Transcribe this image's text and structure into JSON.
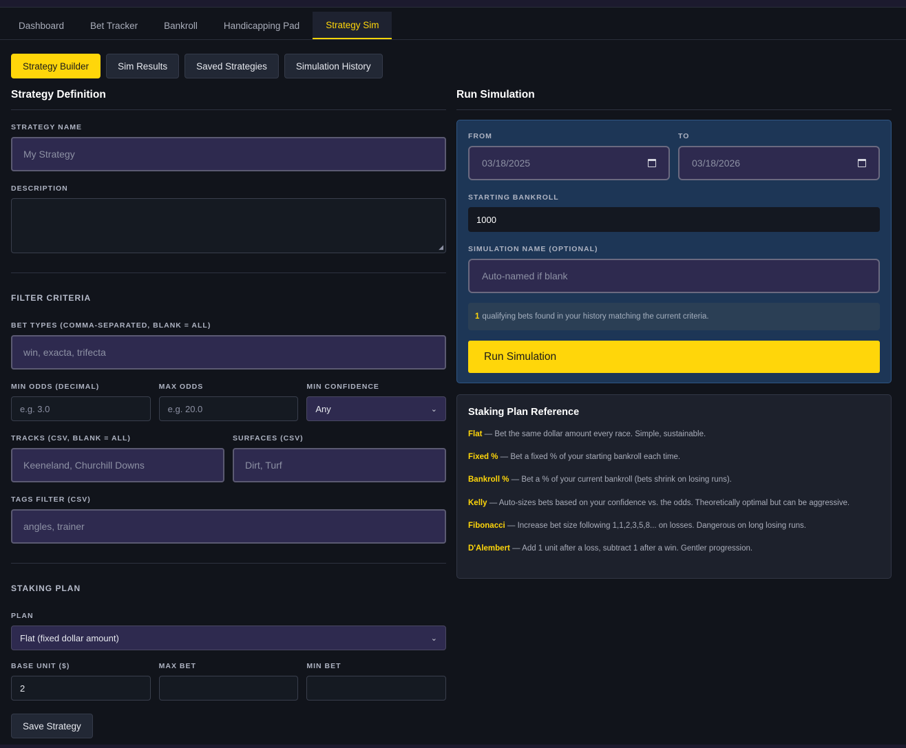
{
  "nav": {
    "tabs": [
      "Dashboard",
      "Bet Tracker",
      "Bankroll",
      "Handicapping Pad",
      "Strategy Sim"
    ],
    "active": "Strategy Sim"
  },
  "subtabs": {
    "items": [
      "Strategy Builder",
      "Sim Results",
      "Saved Strategies",
      "Simulation History"
    ],
    "active": "Strategy Builder"
  },
  "definition": {
    "title": "Strategy Definition",
    "name_label": "STRATEGY NAME",
    "name_placeholder": "My Strategy",
    "description_label": "DESCRIPTION"
  },
  "filters": {
    "heading": "FILTER CRITERIA",
    "bet_types_label": "BET TYPES (COMMA-SEPARATED, BLANK = ALL)",
    "bet_types_placeholder": "win, exacta, trifecta",
    "min_odds_label": "MIN ODDS (DECIMAL)",
    "min_odds_placeholder": "e.g. 3.0",
    "max_odds_label": "MAX ODDS",
    "max_odds_placeholder": "e.g. 20.0",
    "min_confidence_label": "MIN CONFIDENCE",
    "min_confidence_value": "Any",
    "tracks_label": "TRACKS (CSV, BLANK = ALL)",
    "tracks_placeholder": "Keeneland, Churchill Downs",
    "surfaces_label": "SURFACES (CSV)",
    "surfaces_placeholder": "Dirt, Turf",
    "tags_label": "TAGS FILTER (CSV)",
    "tags_placeholder": "angles, trainer"
  },
  "staking": {
    "heading": "STAKING PLAN",
    "plan_label": "PLAN",
    "plan_value": "Flat (fixed dollar amount)",
    "base_unit_label": "BASE UNIT ($)",
    "base_unit_value": "2",
    "max_bet_label": "MAX BET",
    "min_bet_label": "MIN BET",
    "save_label": "Save Strategy"
  },
  "simulation": {
    "title": "Run Simulation",
    "from_label": "FROM",
    "from_value": "03/18/2025",
    "to_label": "TO",
    "to_value": "03/18/2026",
    "bankroll_label": "STARTING BANKROLL",
    "bankroll_value": "1000",
    "sim_name_label": "SIMULATION NAME (OPTIONAL)",
    "sim_name_placeholder": "Auto-named if blank",
    "qualifying_count": "1",
    "qualifying_text": "qualifying bets found in your history matching the current criteria.",
    "run_label": "Run Simulation"
  },
  "reference": {
    "title": "Staking Plan Reference",
    "items": [
      {
        "name": "Flat",
        "desc": "— Bet the same dollar amount every race. Simple, sustainable."
      },
      {
        "name": "Fixed %",
        "desc": "— Bet a fixed % of your starting bankroll each time."
      },
      {
        "name": "Bankroll %",
        "desc": "— Bet a % of your current bankroll (bets shrink on losing runs)."
      },
      {
        "name": "Kelly",
        "desc": "— Auto-sizes bets based on your confidence vs. the odds. Theoretically optimal but can be aggressive."
      },
      {
        "name": "Fibonacci",
        "desc": "— Increase bet size following 1,1,2,3,5,8... on losses. Dangerous on long losing runs."
      },
      {
        "name": "D'Alembert",
        "desc": "— Add 1 unit after a loss, subtract 1 after a win. Gentler progression."
      }
    ]
  },
  "colors": {
    "accent": "#ffd60a",
    "background": "#11141b",
    "sim_panel": "#1d3656",
    "input_purple": "#2e2a4f"
  },
  "icons": {
    "date": "calendar-icon",
    "select": "chevron-down-icon"
  }
}
